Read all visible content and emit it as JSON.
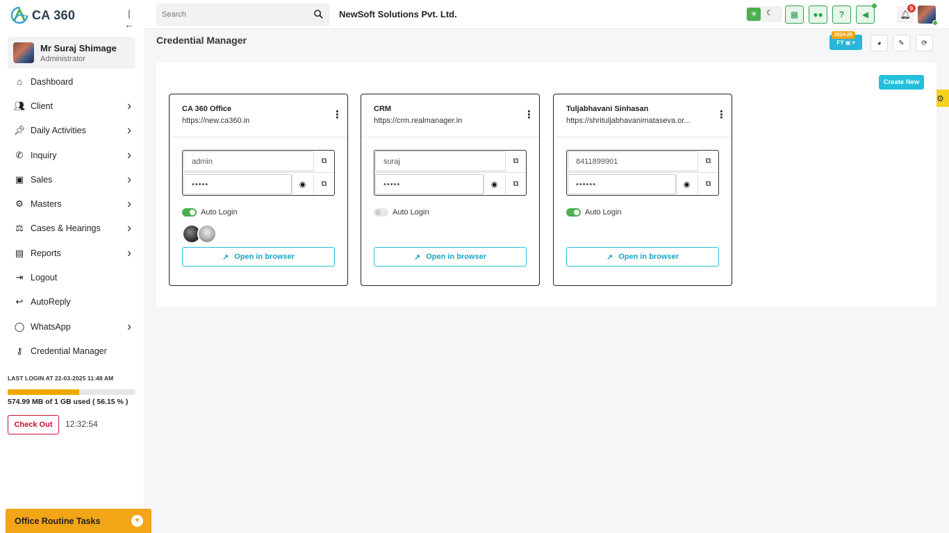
{
  "app": {
    "logo_text": "CA 360"
  },
  "sidebar": {
    "user": {
      "name": "Mr Suraj Shimage",
      "role": "Administrator"
    },
    "items": [
      {
        "label": "Dashboard",
        "icon": "home-icon",
        "chevron": false
      },
      {
        "label": "Client",
        "icon": "users-icon",
        "chevron": true
      },
      {
        "label": "Daily Activities",
        "icon": "pin-icon",
        "chevron": true
      },
      {
        "label": "Inquiry",
        "icon": "phone-icon",
        "chevron": true
      },
      {
        "label": "Sales",
        "icon": "money-icon",
        "chevron": true
      },
      {
        "label": "Masters",
        "icon": "gears-icon",
        "chevron": true
      },
      {
        "label": "Cases & Hearings",
        "icon": "scale-icon",
        "chevron": true
      },
      {
        "label": "Reports",
        "icon": "report-icon",
        "chevron": true
      },
      {
        "label": "Logout",
        "icon": "logout-icon",
        "chevron": false
      },
      {
        "label": "AutoReply",
        "icon": "reply-all-icon",
        "chevron": false
      },
      {
        "label": "WhatsApp",
        "icon": "whatsapp-icon",
        "chevron": true
      },
      {
        "label": "Credential Manager",
        "icon": "key-icon",
        "chevron": false
      }
    ],
    "last_login": "LAST LOGIN AT 22-03-2025 11:48 AM",
    "storage": {
      "text": "574.99 MB of 1 GB used ( 56.15 % )",
      "percent": 56.15
    },
    "checkout_label": "Check Out",
    "clock": "12:32:54",
    "routine_label": "Office Routine Tasks"
  },
  "topbar": {
    "search_placeholder": "Search",
    "company": "NewSoft Solutions Pvt. Ltd.",
    "notification_count": "9"
  },
  "page": {
    "title": "Credential Manager",
    "fy_label": "FY",
    "fy_year": "2024-25",
    "create_label": "Create New"
  },
  "credentials": [
    {
      "title": "CA 360 Office",
      "url": "https://new.ca360.in",
      "username": "admin",
      "password_mask": "•••••",
      "auto_login": true,
      "auto_login_label": "Auto Login",
      "open_label": "Open in browser"
    },
    {
      "title": "CRM",
      "url": "https://crm.realmanager.in",
      "username": "suraj",
      "password_mask": "•••••",
      "auto_login": false,
      "auto_login_label": "Auto Login",
      "open_label": "Open in browser"
    },
    {
      "title": "Tuljabhavani Sinhasan",
      "url": "https://shrituljabhavanimataseva.or...",
      "username": "8411899901",
      "password_mask": "••••••",
      "auto_login": true,
      "auto_login_label": "Auto Login",
      "open_label": "Open in browser"
    }
  ],
  "colors": {
    "accent": "#22c0dc",
    "green": "#4caf50",
    "orange": "#f2a516",
    "danger": "#c8102e"
  }
}
